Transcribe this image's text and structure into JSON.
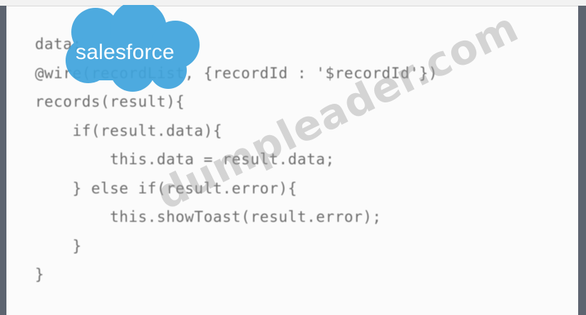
{
  "code": {
    "lines": [
      "data;",
      "@wire(recordList, {recordId : '$recordId'})",
      "records(result){",
      "    if(result.data){",
      "        this.data = result.data;",
      "    } else if(result.error){",
      "        this.showToast(result.error);",
      "    }",
      "}"
    ]
  },
  "logo": {
    "text": "salesforce",
    "color": "#3fa4dd"
  },
  "watermark": {
    "text": "dumpleader.com"
  }
}
